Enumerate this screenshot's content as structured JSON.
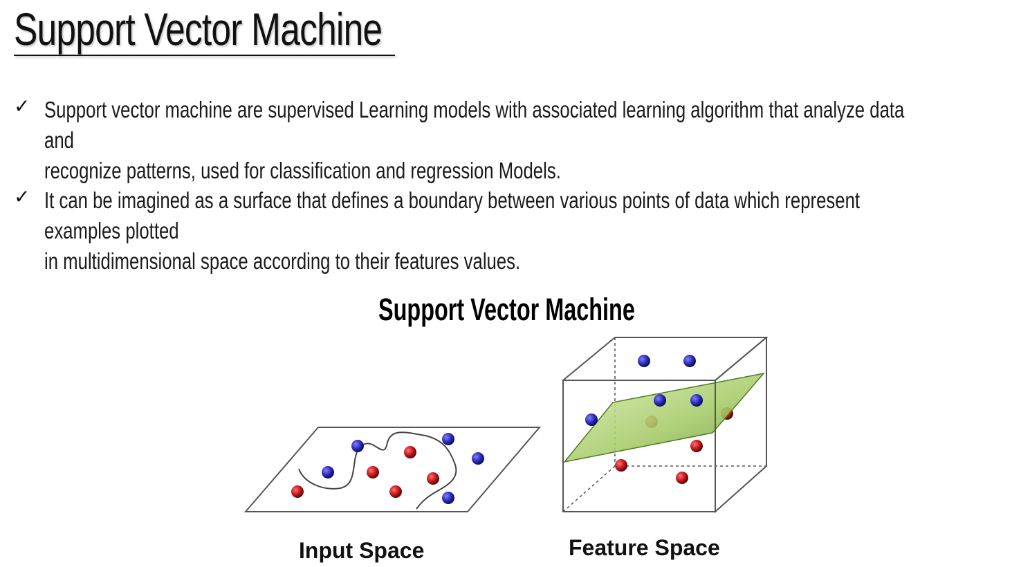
{
  "slide": {
    "title": "Support Vector Machine",
    "bullets": [
      {
        "icon": "checkmark-icon",
        "line1": "Support vector machine are supervised Learning models with associated learning algorithm that analyze data and",
        "line2": "recognize patterns, used for classification and regression Models."
      },
      {
        "icon": "checkmark-icon",
        "line1": "It can be imagined as  a surface that defines a boundary between various points of data which represent examples plotted",
        "line2": "in multidimensional space according to their features values."
      }
    ]
  },
  "figure": {
    "title": "Support Vector Machine",
    "input_space_label": "Input Space",
    "feature_space_label": "Feature Space",
    "colors": {
      "class_a": "#2b2bb8",
      "class_b": "#c4161c",
      "hyperplane": "#a8cc6a"
    }
  }
}
